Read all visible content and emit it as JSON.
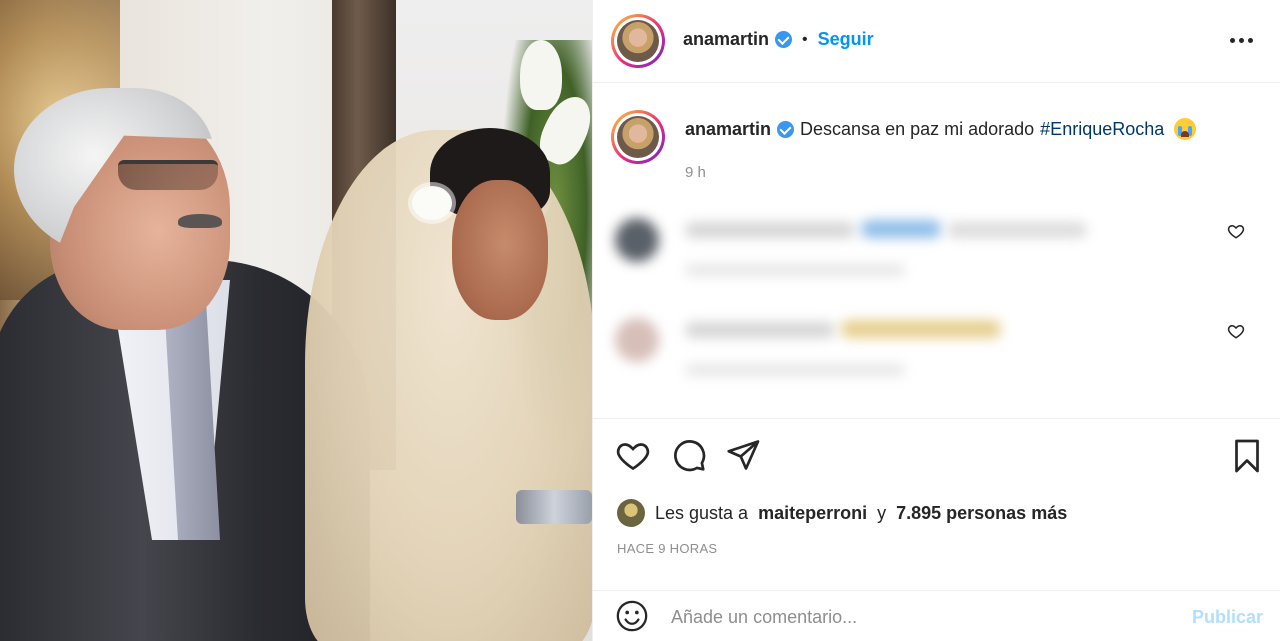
{
  "post": {
    "username": "anamartin",
    "follow_label": "Seguir",
    "separator": "•",
    "caption_text": "Descansa en paz mi adorado",
    "caption_hashtag": "#EnriqueRocha",
    "caption_time": "9 h"
  },
  "likes": {
    "prefix": "Les gusta a",
    "first_user": "maiteperroni",
    "connector": "y",
    "others": "7.895 personas más"
  },
  "posted_ago": "HACE 9 HORAS",
  "comment_box": {
    "placeholder": "Añade un comentario...",
    "publish_label": "Publicar"
  },
  "colors": {
    "link_blue": "#0095f6",
    "hashtag": "#00376b",
    "secondary_text": "#8e8e8e",
    "publish_disabled": "#b2dffc",
    "verified": "#3897f0"
  },
  "icons": [
    "more-options-icon",
    "verified-badge-icon",
    "heart-icon",
    "comment-icon",
    "share-icon",
    "bookmark-icon",
    "emoji-icon",
    "crying-emoji-icon"
  ]
}
